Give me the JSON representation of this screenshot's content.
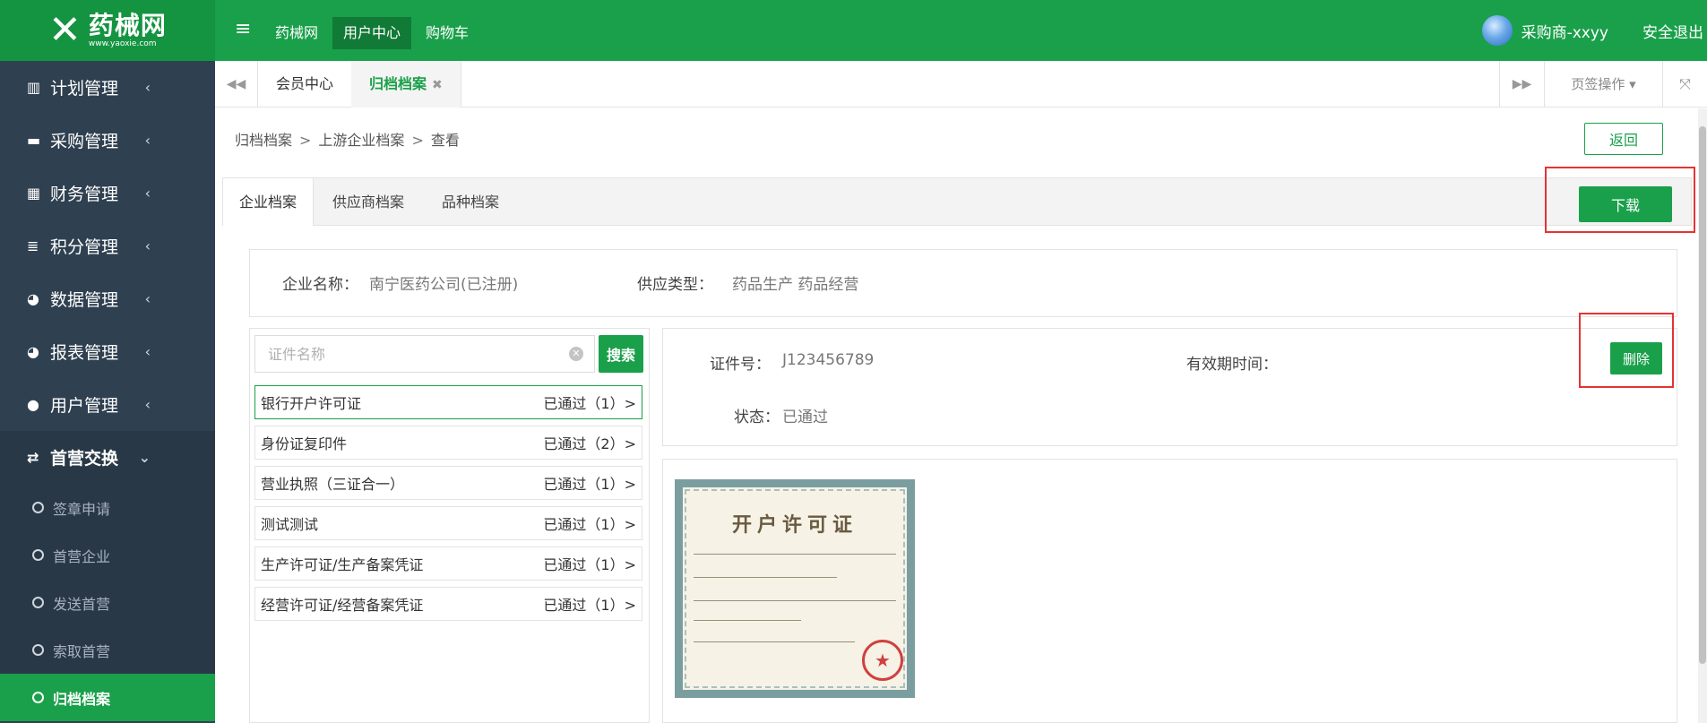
{
  "brand": {
    "name": "药械网",
    "url": "www.yaoxie.com"
  },
  "topnav": {
    "items": [
      "药械网",
      "用户中心",
      "购物车"
    ],
    "active_index": 1
  },
  "user": {
    "name": "采购商-xxyy",
    "logout": "安全退出"
  },
  "sidebar": {
    "items": [
      {
        "label": "计划管理",
        "icon": "bar-chart-icon"
      },
      {
        "label": "采购管理",
        "icon": "briefcase-icon"
      },
      {
        "label": "财务管理",
        "icon": "calculator-icon"
      },
      {
        "label": "积分管理",
        "icon": "database-icon"
      },
      {
        "label": "数据管理",
        "icon": "pie-chart-icon"
      },
      {
        "label": "报表管理",
        "icon": "pie-chart-icon"
      },
      {
        "label": "用户管理",
        "icon": "user-icon"
      },
      {
        "label": "首营交换",
        "icon": "exchange-icon",
        "open": true
      }
    ],
    "subitems": [
      "签章申请",
      "首营企业",
      "发送首营",
      "索取首营",
      "归档档案"
    ],
    "active_sub": "归档档案"
  },
  "page_tabs": {
    "tab1": "会员中心",
    "tab2": "归档档案",
    "ops": "页签操作"
  },
  "breadcrumb": {
    "c1": "归档档案",
    "c2": "上游企业档案",
    "c3": "查看",
    "sep": ">"
  },
  "buttons": {
    "back": "返回",
    "download": "下载",
    "search": "搜索",
    "delete": "删除"
  },
  "content_tabs": [
    "企业档案",
    "供应商档案",
    "品种档案"
  ],
  "company": {
    "name_label": "企业名称：",
    "name": "南宁医药公司(已注册)",
    "type_label": "供应类型：",
    "type": "药品生产 药品经营"
  },
  "search": {
    "placeholder": "证件名称"
  },
  "certificates": [
    {
      "name": "银行开户许可证",
      "status": "已通过（1）>"
    },
    {
      "name": "身份证复印件",
      "status": "已通过（2）>"
    },
    {
      "name": "营业执照（三证合一）",
      "status": "已通过（1）>"
    },
    {
      "name": "测试测试",
      "status": "已通过（1）>"
    },
    {
      "name": "生产许可证/生产备案凭证",
      "status": "已通过（1）>"
    },
    {
      "name": "经营许可证/经营备案凭证",
      "status": "已通过（1）>"
    }
  ],
  "detail": {
    "cert_no_label": "证件号：",
    "cert_no": "J123456789",
    "valid_label": "有效期时间：",
    "valid": "",
    "status_label": "状态：",
    "status": "已通过"
  },
  "license_image": {
    "title": "开户许可证"
  },
  "colors": {
    "brand_green": "#1aa04a",
    "sidebar_bg": "#2f4050",
    "highlight_red": "#e53333"
  }
}
